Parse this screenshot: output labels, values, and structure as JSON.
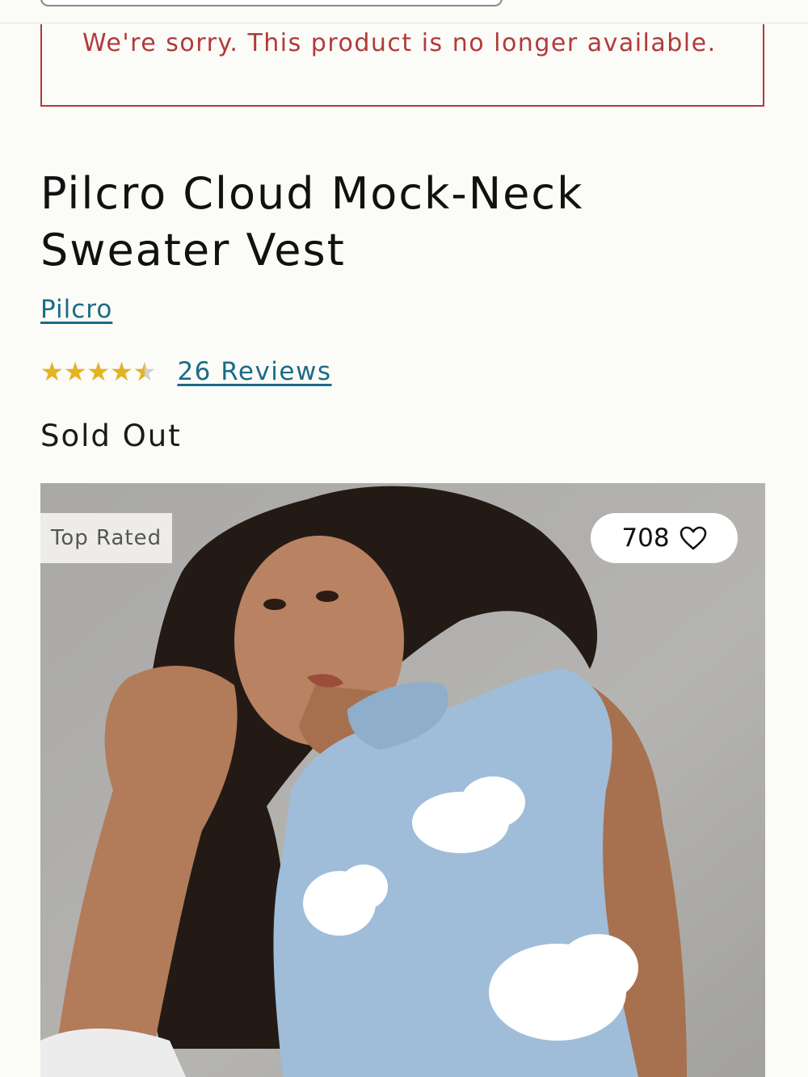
{
  "alert": {
    "message": "We're sorry. This product is no longer available."
  },
  "product": {
    "title": "Pilcro Cloud Mock-Neck Sweater Vest",
    "brand": "Pilcro",
    "rating": 4.5,
    "rating_max": 5,
    "reviews_label": "26 Reviews",
    "stock_status": "Sold Out",
    "badge": "Top Rated",
    "favorites_count": "708"
  },
  "icons": {
    "rating": "star-icon",
    "favorite": "heart-outline-icon"
  },
  "colors": {
    "alert": "#b23a3a",
    "link": "#1b6b87",
    "star_filled": "#e4b321",
    "star_empty": "#cfcfcf",
    "vest": "#9fbdd9"
  }
}
